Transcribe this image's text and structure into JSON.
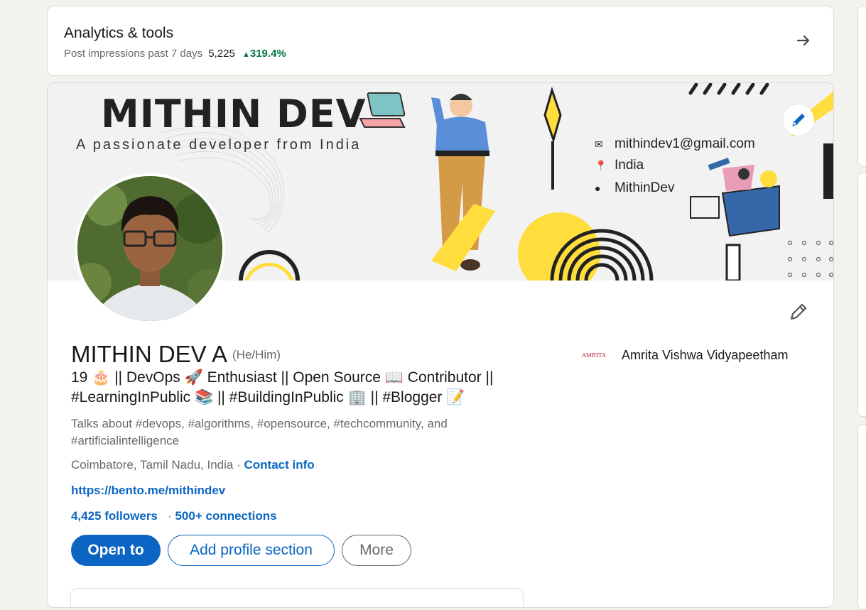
{
  "analytics": {
    "title": "Analytics & tools",
    "impressions_label": "Post impressions past 7 days",
    "impressions_value": "5,225",
    "impressions_change": "319.4%",
    "arrow_icon": "arrow-right-icon"
  },
  "banner": {
    "name": "MITHIN DEV",
    "tagline": "A passionate developer from India",
    "email": "mithindev1@gmail.com",
    "location": "India",
    "handle": "MithinDev",
    "edit_icon": "pencil-icon"
  },
  "profile": {
    "name": "MITHIN DEV A",
    "pronouns": "(He/Him)",
    "headline_line1": "19 🎂 || DevOps 🚀 Enthusiast || Open Source 📖 Contributor ||",
    "headline_line2": "#LearningInPublic 📚 || #BuildingInPublic 🏢 || #Blogger 📝",
    "talks_about": "Talks about #devops, #algorithms, #opensource, #techcommunity, and #artificialintelligence",
    "location": "Coimbatore, Tamil Nadu, India",
    "separator": "·",
    "contact_info": "Contact info",
    "website": "https://bento.me/mithindev",
    "followers": "4,425 followers",
    "connections": "500+ connections",
    "education_logo_text": "AMRITA",
    "education": "Amrita Vishwa Vidyapeetham"
  },
  "actions": {
    "open_to": "Open to",
    "add_section": "Add profile section",
    "more": "More"
  },
  "colors": {
    "primary": "#0a66c2",
    "positive": "#057642",
    "page_bg": "#f3f2ef",
    "banner_yellow": "#ffdd3c"
  }
}
